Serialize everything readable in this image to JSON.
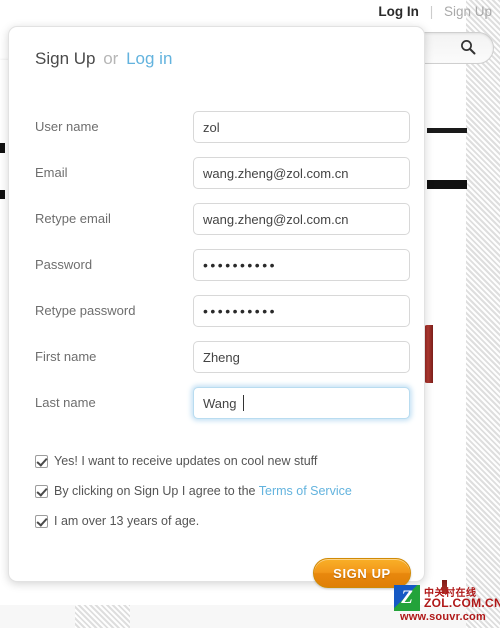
{
  "top_links": {
    "login": "Log In",
    "divider": "|",
    "signup": "Sign Up"
  },
  "background": {
    "search_placeholder": "",
    "search_icon": "search-icon"
  },
  "modal": {
    "header": {
      "signup": "Sign Up",
      "or": "or",
      "login": "Log in"
    },
    "fields": [
      {
        "label": "User name",
        "value": "zol",
        "type": "text",
        "focused": false
      },
      {
        "label": "Email",
        "value": "wang.zheng@zol.com.cn",
        "type": "text",
        "focused": false
      },
      {
        "label": "Retype email",
        "value": "wang.zheng@zol.com.cn",
        "type": "text",
        "focused": false
      },
      {
        "label": "Password",
        "value": "••••••••••",
        "type": "password",
        "focused": false
      },
      {
        "label": "Retype password",
        "value": "••••••••••",
        "type": "password",
        "focused": false
      },
      {
        "label": "First name",
        "value": "Zheng",
        "type": "text",
        "focused": false
      },
      {
        "label": "Last name",
        "value": "Wang",
        "type": "text",
        "focused": true
      }
    ],
    "checkboxes": [
      {
        "checked": true,
        "text": "Yes! I want to receive updates on cool new stuff",
        "link": ""
      },
      {
        "checked": true,
        "text": "By clicking on Sign Up I agree to the ",
        "link": "Terms of Service"
      },
      {
        "checked": true,
        "text": "I am over 13 years of age.",
        "link": ""
      }
    ],
    "submit_label": "SIGN UP"
  },
  "watermark": {
    "logo_letter": "Z",
    "chinese": "中关村在线",
    "english": "ZOL.COM.CN",
    "url": "www.souvr.com"
  },
  "colors": {
    "link_blue": "#63b3de",
    "button_orange": "#f2971a",
    "label_grey": "#6e6e6e",
    "watermark_red": "#b01818"
  }
}
